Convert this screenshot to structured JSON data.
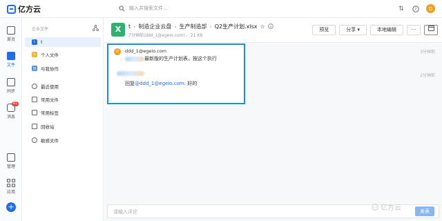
{
  "app": {
    "logo_text": "亿方云"
  },
  "search": {
    "placeholder": "输入并搜索文件..."
  },
  "topbar": {
    "avatar_letter": "D"
  },
  "rail": {
    "items": [
      {
        "label": "首页"
      },
      {
        "label": "文件"
      },
      {
        "label": "同步"
      },
      {
        "label": "消息",
        "badge": "41"
      },
      {
        "label": "管理"
      },
      {
        "label": "应用"
      }
    ],
    "add_label": "+"
  },
  "sidebar": {
    "heading": "企业文件",
    "items": [
      {
        "label": "t",
        "icon": "t"
      },
      {
        "label": "个人文件",
        "icon": "个"
      },
      {
        "label": "与我协作",
        "icon": "协"
      },
      {
        "label": "最近使用"
      },
      {
        "label": "常用文件"
      },
      {
        "label": "常用标签"
      },
      {
        "label": "回收站"
      },
      {
        "label": "敏感文件"
      }
    ]
  },
  "file": {
    "icon_letter": "X",
    "breadcrumb": [
      "t",
      "制造企业云盘",
      "生产制造部",
      "Q2生产计划.xlsx"
    ],
    "meta": "7分钟前(ddd_1@egeio.com)， 21 KB"
  },
  "toolbar": {
    "preview": "预览",
    "share": "分享",
    "local_edit": "本地编辑",
    "more": "···"
  },
  "comments": [
    {
      "avatar": "D",
      "name": "ddd_1@egeio.com",
      "text": "最新版的生产计划表，按这个执行",
      "time": "3分钟前"
    },
    {
      "reply_prefix": "回复",
      "mention": "@ddd_1@egeio.com",
      "text": ": 好的",
      "time": "2分钟前"
    }
  ],
  "input": {
    "placeholder": "请输入评论",
    "send": "发表"
  },
  "watermark": "亿方云"
}
